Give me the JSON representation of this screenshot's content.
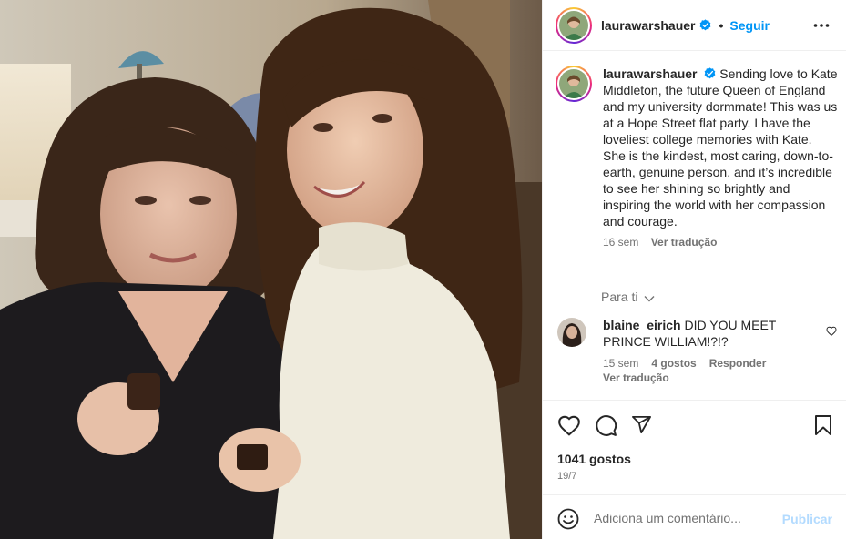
{
  "header": {
    "username": "laurawarshauer",
    "separator": "•",
    "follow_label": "Seguir",
    "more_icon": "more-horizontal-icon"
  },
  "caption": {
    "username": "laurawarshauer",
    "text": "Sending love to Kate Middleton, the future Queen of England and my university dormmate! This was us at a Hope Street flat party. I have the loveliest college memories with Kate. She is the kindest, most caring, down-to-earth, genuine person, and it’s incredible to see her shining so brightly and inspiring the world with her compassion and courage.",
    "time": "16 sem",
    "translate_label": "Ver tradução"
  },
  "filter": {
    "label": "Para ti"
  },
  "comments": [
    {
      "username": "blaine_eirich",
      "text": "DID YOU MEET PRINCE WILLIAM!?!?",
      "time": "15 sem",
      "likes": "4 gostos",
      "reply_label": "Responder",
      "translate_label": "Ver tradução"
    }
  ],
  "actions": {
    "likes": "1041 gostos",
    "date": "19/7"
  },
  "add_comment": {
    "placeholder": "Adiciona um comentário...",
    "publish_label": "Publicar"
  },
  "colors": {
    "accent": "#0095f6",
    "publish_disabled": "#b3dbff",
    "secondary_text": "#737373"
  }
}
